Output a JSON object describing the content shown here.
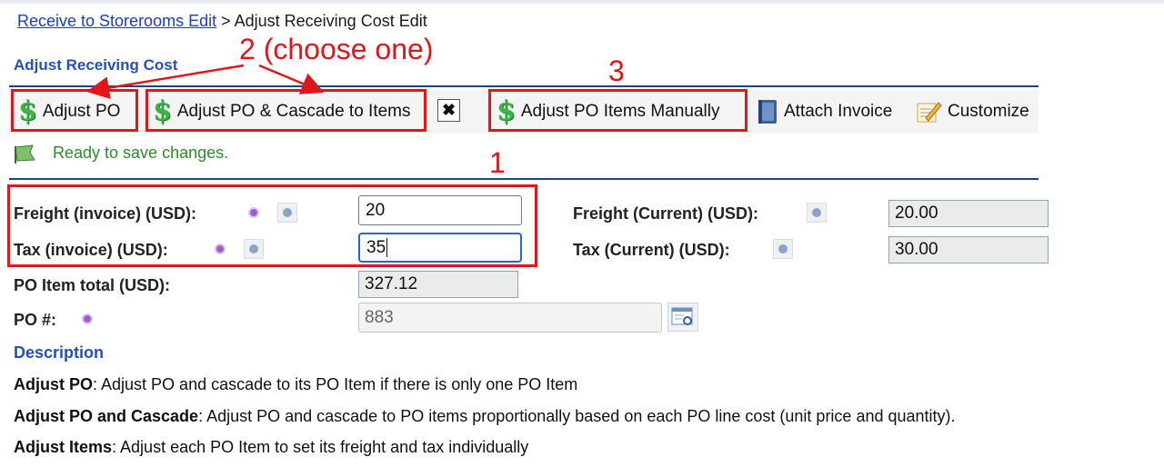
{
  "breadcrumb": {
    "link": "Receive to Storerooms Edit",
    "separator": " > ",
    "current": "Adjust Receiving Cost Edit"
  },
  "section_title": "Adjust Receiving Cost",
  "toolbar": {
    "adjust_po": "Adjust PO",
    "adjust_po_cascade": "Adjust PO & Cascade to Items",
    "close_icon": "close-icon",
    "adjust_items_manually": "Adjust PO Items Manually",
    "attach_invoice": "Attach Invoice",
    "customize": "Customize"
  },
  "status": {
    "icon": "flag-icon",
    "text": "Ready to save changes."
  },
  "annotations": {
    "one": "1",
    "two": "2 (choose one)",
    "three": "3",
    "color": "#e0161b"
  },
  "form": {
    "freight_invoice": {
      "label": "Freight (invoice) (USD):",
      "value": "20"
    },
    "tax_invoice": {
      "label": "Tax (invoice) (USD):",
      "value": "35"
    },
    "freight_current": {
      "label": "Freight (Current) (USD):",
      "value": "20.00"
    },
    "tax_current": {
      "label": "Tax (Current) (USD):",
      "value": "30.00"
    },
    "po_item_total": {
      "label": "PO Item total (USD):",
      "value": "327.12"
    },
    "po_number": {
      "label": "PO #:",
      "value": "883"
    }
  },
  "description": {
    "title": "Description",
    "lines": [
      {
        "term": "Adjust PO",
        "text": ": Adjust PO and cascade to its PO Item if there is only one PO Item"
      },
      {
        "term": "Adjust PO and Cascade",
        "text": ": Adjust PO and cascade to PO items proportionally based on each PO line cost (unit price and quantity)."
      },
      {
        "term": "Adjust Items",
        "text": ": Adjust each PO Item to set its freight and tax individually"
      }
    ]
  },
  "colors": {
    "accent": "#2850b0",
    "rule": "#1e3f8c",
    "status": "#2b8a2b",
    "annotation": "#e0161b"
  }
}
